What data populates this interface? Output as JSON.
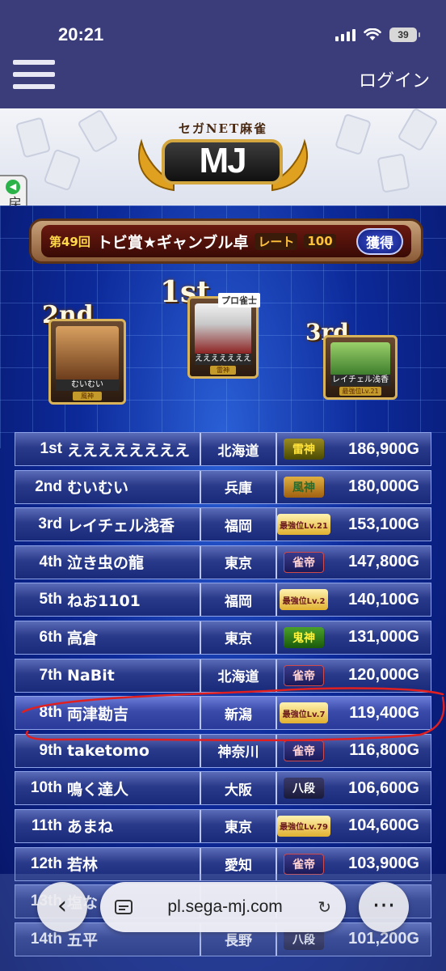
{
  "status_bar": {
    "time": "20:21",
    "battery": "39"
  },
  "header": {
    "login_label": "ログイン"
  },
  "logo": {
    "subtitle": "セガNET麻雀",
    "main": "MJ"
  },
  "back_button": {
    "label": "戻る"
  },
  "event": {
    "round": "第49回",
    "title": "トビ賞★ギャンブル卓",
    "rate_label": "レート",
    "rate_value": "100",
    "button_label": "獲得"
  },
  "podium": {
    "first": {
      "place": "1st",
      "name": "ええええええええ",
      "title": "雷神",
      "badge": "プロ雀士"
    },
    "second": {
      "place": "2nd",
      "name": "むいむい",
      "title": "風神"
    },
    "third": {
      "place": "3rd",
      "name": "レイチェル浅香",
      "title": "最強位Lv.21"
    }
  },
  "rankings": [
    {
      "pos": "1st",
      "name": "ええええええええ",
      "pref": "北海道",
      "title": "雷神",
      "points": "186,900G",
      "title_style": "thunder"
    },
    {
      "pos": "2nd",
      "name": "むいむい",
      "pref": "兵庫",
      "title": "風神",
      "points": "180,000G",
      "title_style": "wind"
    },
    {
      "pos": "3rd",
      "name": "レイチェル浅香",
      "pref": "福岡",
      "title": "最強位Lv.21",
      "points": "153,100G",
      "title_style": "strong"
    },
    {
      "pos": "4th",
      "name": "泣き虫の龍",
      "pref": "東京",
      "title": "雀帝",
      "points": "147,800G",
      "title_style": "emperor"
    },
    {
      "pos": "5th",
      "name": "ねお1101",
      "pref": "福岡",
      "title": "最強位Lv.2",
      "points": "140,100G",
      "title_style": "strong"
    },
    {
      "pos": "6th",
      "name": "高倉",
      "pref": "東京",
      "title": "鬼神",
      "points": "131,000G",
      "title_style": "oni"
    },
    {
      "pos": "7th",
      "name": "NaBit",
      "pref": "北海道",
      "title": "雀帝",
      "points": "120,000G",
      "title_style": "emperor"
    },
    {
      "pos": "8th",
      "name": "両津勘吉",
      "pref": "新潟",
      "title": "最強位Lv.7",
      "points": "119,400G",
      "title_style": "strong"
    },
    {
      "pos": "9th",
      "name": "taketomo",
      "pref": "神奈川",
      "title": "雀帝",
      "points": "116,800G",
      "title_style": "emperor"
    },
    {
      "pos": "10th",
      "name": "鳴く達人",
      "pref": "大阪",
      "title": "八段",
      "points": "106,600G",
      "title_style": "dan"
    },
    {
      "pos": "11th",
      "name": "あまね",
      "pref": "東京",
      "title": "最強位Lv.79",
      "points": "104,600G",
      "title_style": "strong"
    },
    {
      "pos": "12th",
      "name": "若林",
      "pref": "愛知",
      "title": "雀帝",
      "points": "103,900G",
      "title_style": "emperor"
    },
    {
      "pos": "13th",
      "name": "塩な",
      "pref": "",
      "title": "",
      "points": "",
      "title_style": "strong"
    },
    {
      "pos": "14th",
      "name": "五平",
      "pref": "長野",
      "title": "八段",
      "points": "101,200G",
      "title_style": "dan"
    }
  ],
  "browser": {
    "url": "pl.sega-mj.com"
  },
  "colors": {
    "header_bg": "#3b3c7a",
    "annotation": "#e02020"
  }
}
